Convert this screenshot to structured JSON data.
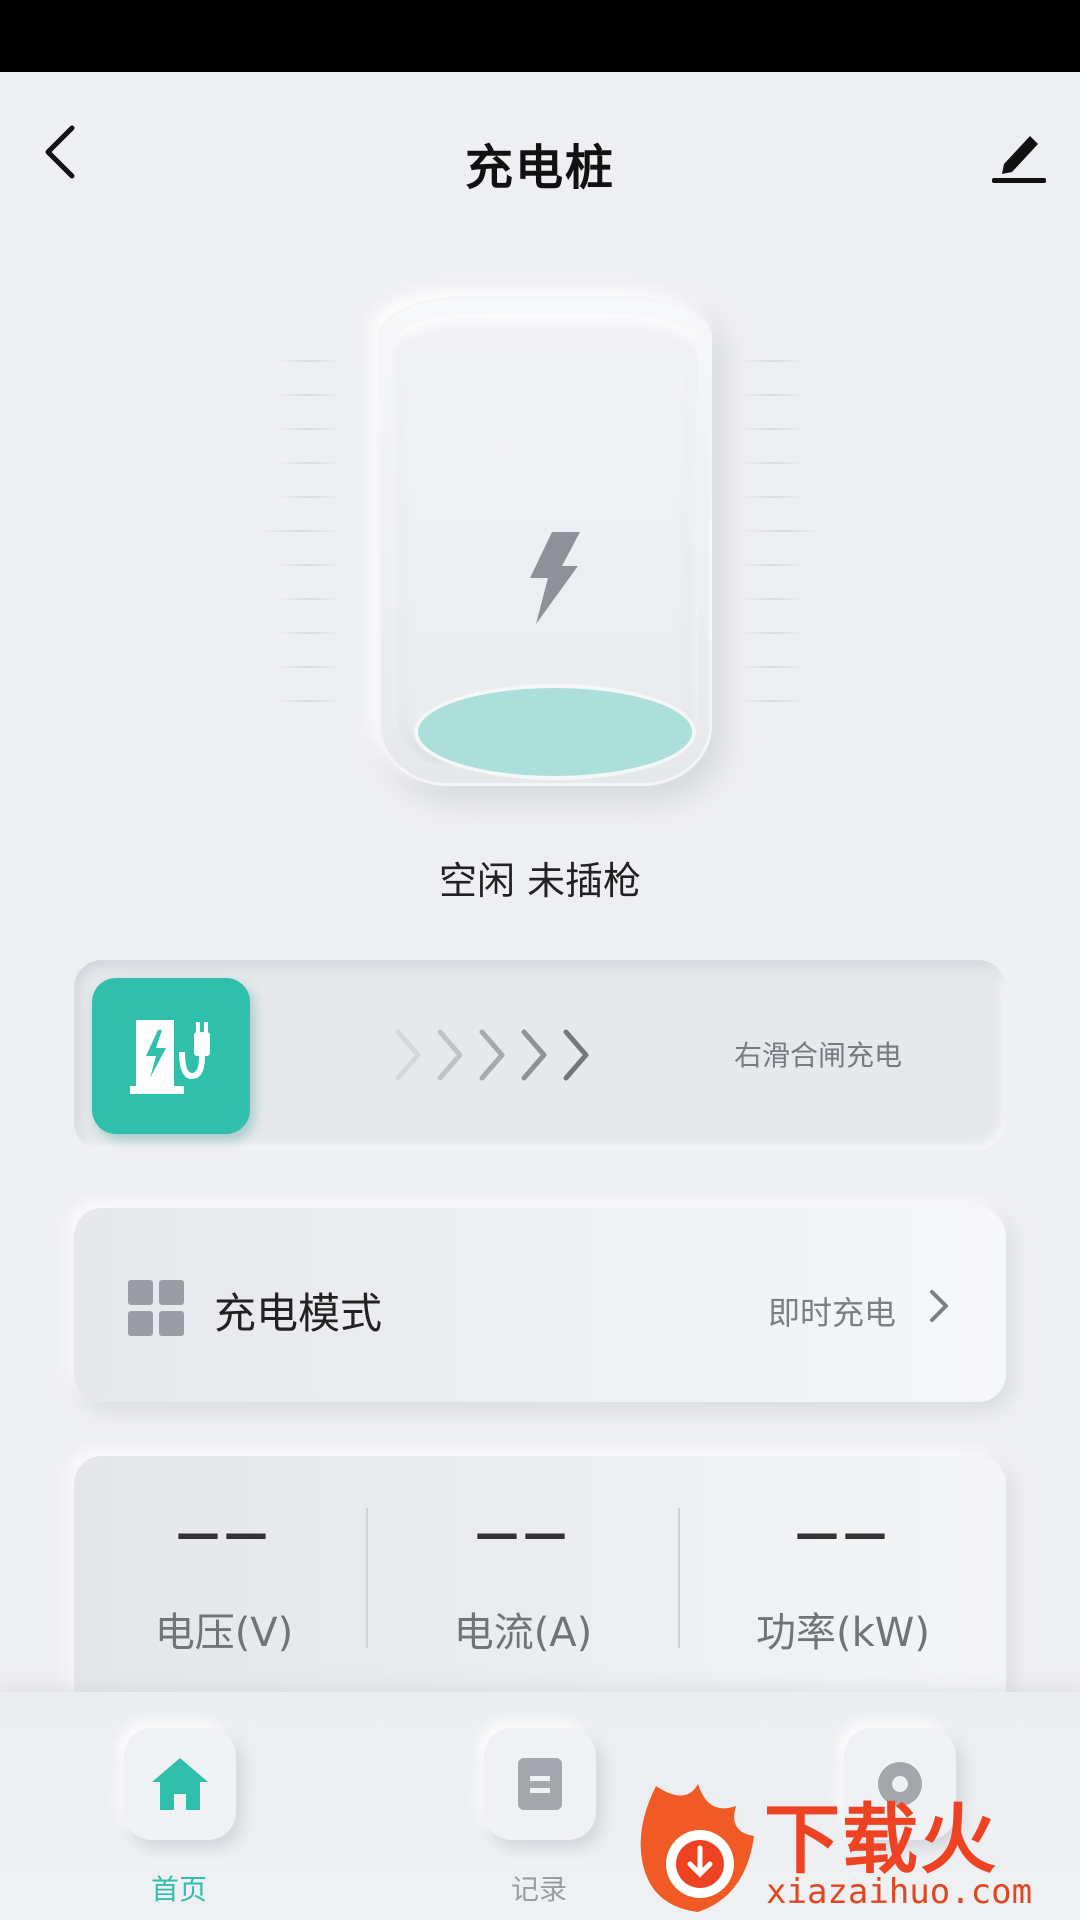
{
  "header": {
    "title": "充电桩"
  },
  "charger": {
    "status": "空闲 未插枪"
  },
  "slide": {
    "hint": "右滑合闸充电"
  },
  "mode": {
    "label": "充电模式",
    "value": "即时充电"
  },
  "metrics": [
    {
      "value": "——",
      "label": "电压(V)"
    },
    {
      "value": "——",
      "label": "电流(A)"
    },
    {
      "value": "——",
      "label": "功率(kW)"
    }
  ],
  "nav": {
    "items": [
      {
        "label": "首页",
        "icon": "home-icon",
        "active": true
      },
      {
        "label": "记录",
        "icon": "record-icon",
        "active": false
      },
      {
        "label": "",
        "icon": "settings-icon",
        "active": false
      }
    ]
  },
  "watermark": {
    "brand": "下载火",
    "url": "xiazaihuo.com"
  },
  "colors": {
    "accent": "#2fbfaa",
    "background": "#eeeff3",
    "watermark": "#ee4322"
  }
}
